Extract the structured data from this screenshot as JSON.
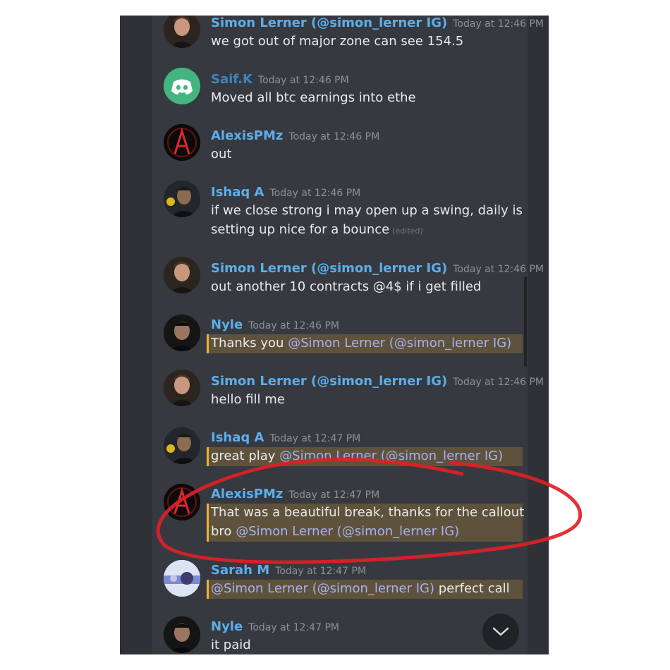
{
  "messages": [
    {
      "username": "Simon Lerner (@simon_lerner IG)",
      "time": "Today at 12:46 PM",
      "lines": [
        "we got out of major zone can see 154.5"
      ]
    },
    {
      "username": "Saif.K",
      "time": "Today at 12:46 PM",
      "lines": [
        "Moved all btc earnings into ethe"
      ]
    },
    {
      "username": "AlexisPMz",
      "time": "Today at 12:46 PM",
      "lines": [
        "out"
      ]
    },
    {
      "username": "Ishaq A",
      "time": "Today at 12:46 PM",
      "lines": [
        "if we close strong i may open up a swing, daily is",
        "setting up nice for a bounce"
      ],
      "edited": "(edited)"
    },
    {
      "username": "Simon Lerner (@simon_lerner IG)",
      "time": "Today at 12:46 PM",
      "lines": [
        "out another 10 contracts @4$ if i get filled"
      ]
    },
    {
      "username": "Nyle",
      "time": "Today at 12:46 PM",
      "text": "Thanks you",
      "mention": "@Simon Lerner (@simon_lerner IG)"
    },
    {
      "username": "Simon Lerner (@simon_lerner IG)",
      "time": "Today at 12:46 PM",
      "lines": [
        "hello fill me"
      ]
    },
    {
      "username": "Ishaq A",
      "time": "Today at 12:47 PM",
      "text": "great play",
      "mention": "@Simon Lerner (@simon_lerner IG)"
    },
    {
      "username": "AlexisPMz",
      "time": "Today at 12:47 PM",
      "line1": "That was a beautiful break, thanks for the callout",
      "line2": "bro",
      "mention": "@Simon Lerner (@simon_lerner IG)"
    },
    {
      "username": "Sarah M",
      "time": "Today at 12:47 PM",
      "mention": "@Simon Lerner (@simon_lerner IG)",
      "text": "perfect call"
    },
    {
      "username": "Nyle",
      "time": "Today at 12:47 PM",
      "lines": [
        "it paid"
      ]
    }
  ],
  "annotation_color": "#e02026",
  "mention_highlight_color": "#f0b232",
  "icons": {
    "jump_to_present": "chevron-down-icon"
  }
}
